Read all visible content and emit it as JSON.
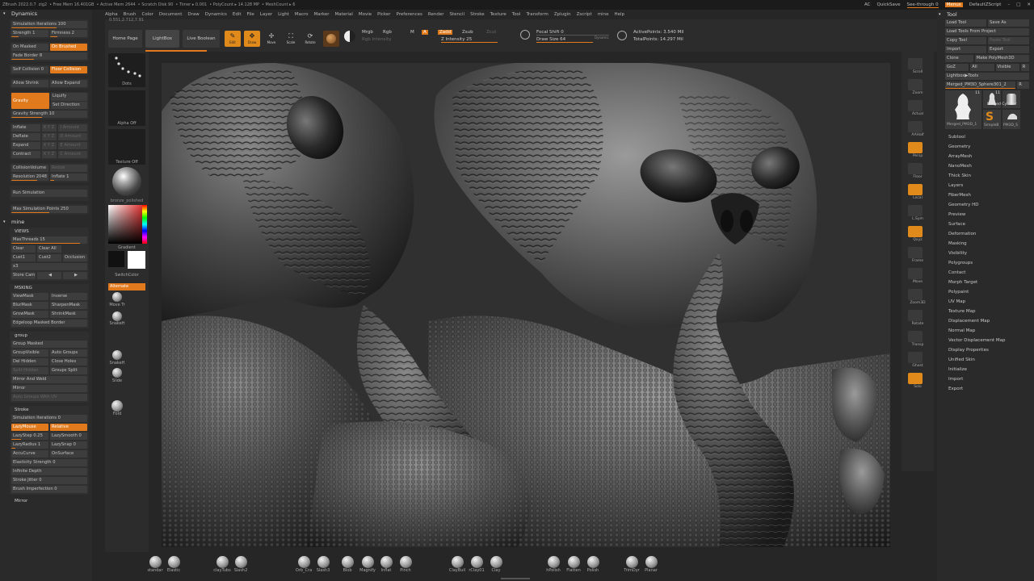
{
  "titlebar": {
    "items": [
      "ZBrush 2022.0.7",
      "zig2",
      "• Free Mem 16.401GB",
      "• Active Mem 2644",
      "• Scratch Disk 90",
      "• Timer ▸ 0.001",
      "• PolyCount ▸ 14.128 MP",
      "• MeshCount ▸ 6"
    ],
    "right": {
      "ac": "AC",
      "quicksave": "QuickSave",
      "seethrough": "See-through 0",
      "menus": "Menus",
      "script": "DefaultZScript"
    }
  },
  "menubar": [
    "Alpha",
    "Brush",
    "Color",
    "Document",
    "Draw",
    "Dynamics",
    "Edit",
    "File",
    "Layer",
    "Light",
    "Macro",
    "Marker",
    "Material",
    "Movie",
    "Picker",
    "Preferences",
    "Render",
    "Stencil",
    "Stroke",
    "Texture",
    "Tool",
    "Transform",
    "Zplugin",
    "Zscript",
    "mine",
    "Help"
  ],
  "coords": "0.551,2.712,7.91",
  "left": {
    "dynamics_title": "Dynamics",
    "sim_iterations": "Simulation Iterations 100",
    "strength": "Strength 1",
    "firmness": "Firmness 2",
    "on_masked": "On Masked",
    "on_brushed": "On Brushed",
    "fade_border": "Fade Border 8",
    "self_collision": "Self Collision 0",
    "floor_collision": "Floor Collision",
    "allow_shrink": "Allow Shrink",
    "allow_expand": "Allow Expand",
    "gravity": "Gravity",
    "liquify": "Liquify",
    "set_direction": "Set Direction",
    "gravity_strength": "Gravity Strength 10",
    "inflate": "Inflate",
    "deflate": "Deflate",
    "expand": "Expand",
    "contract": "Contract",
    "axes": "X Y Z",
    "amount_i": "I Amount",
    "amount_d": "D Amount",
    "amount_e": "E Amount",
    "amount_c": "C Amount",
    "collision_volume": "CollisionVolume",
    "resize": "Resize",
    "resolution": "Resolution 2048",
    "inflate1": "Inflate 1",
    "run_simulation": "Run Simulation",
    "max_sim_points": "Max Simulation Points 250",
    "mine_title": "mine",
    "views": "VIEWS",
    "max_threads": "MaxThreads 15",
    "clear": "Clear",
    "clear_all": "Clear All",
    "cust1": "Cust1",
    "cust2": "Cust2",
    "occlusion": "Occlusion",
    "x3": "x3",
    "store_cam": "Store Cam",
    "prev": "◀",
    "next": "▶",
    "masking": "MSKING",
    "view_mask": "ViewMask",
    "inverse": "Inverse",
    "blur_mask": "BlurMask",
    "sharpen_mask": "SharpenMask",
    "grow_mask": "GrowMask",
    "shrink_mask": "ShrinkMask",
    "edgeloop": "Edgeloop Masked Border",
    "group": "group",
    "group_masked": "Group Masked",
    "group_visible": "GroupVisible",
    "auto_groups": "Auto Groups",
    "del_hidden": "Del Hidden",
    "close_holes": "Close Holes",
    "split_hidden": "Split Hidden",
    "groups_split": "Groups Split",
    "mirror_weld": "Mirror And Weld",
    "mirror": "Mirror",
    "auto_groups_uv": "Auto Groups With UV",
    "stroke": "Stroke",
    "stroke_sim_iter": "Simulation Iterations 0",
    "lazy_mouse": "LazyMouse",
    "relative": "Relative",
    "lazy_step": "LazyStep 0.25",
    "lazy_smooth": "LazySmooth 0",
    "lazy_radius": "LazyRadius 1",
    "lazy_snap": "LazySnap 0",
    "accu_curve": "AccuCurve",
    "on_surface": "OnSurface",
    "elasticity": "Elasticity Strength 0",
    "infinite_depth": "Infinite Depth",
    "stroke_jitter": "Stroke Jitter 0",
    "brush_imperfection": "Brush Imperfection 0",
    "mirror2": "Mirror"
  },
  "toolstrip": {
    "home": "Home Page",
    "lightbox": "LightBox",
    "live_boolean": "Live Boolean",
    "edit": "Edit",
    "draw": "Draw",
    "move": "Move",
    "scale": "Scale",
    "rotate": "Rotate",
    "mrgb": "Mrgb",
    "rgb": "Rgb",
    "m": "M",
    "rgb_intensity": "Rgb Intensity",
    "a": "A",
    "zadd": "Zadd",
    "zsub": "Zsub",
    "zcut": "Zcut",
    "z_intensity": "Z Intensity 25",
    "focal_shift": "Focal Shift 0",
    "draw_size": "Draw Size 64",
    "dynamic": "Dynamic",
    "active_points": "ActivePoints: 3.540 Mil",
    "total_points": "TotalPoints: 14.297 Mil"
  },
  "shelf": {
    "dots": "Dots",
    "alpha_off": "Alpha Off",
    "texture_off": "Texture Off",
    "material": "bronze_polished",
    "gradient": "Gradient",
    "switch_color": "SwitchColor",
    "alternate": "Alternate",
    "move_tr": "Move Tr",
    "snakeh": "SnakeH",
    "snakeh2": "SnakeH",
    "slide": "Slide",
    "fold": "Fold"
  },
  "rightshelf": [
    "Scroll",
    "Zoom",
    "Actual",
    "AAHalf",
    "Persp",
    "Floor",
    "Local",
    "L.Sym",
    "Qxyz",
    "Frame",
    "Move",
    "Zoom3D",
    "Rotate",
    "Transp",
    "Ghost",
    "Solo"
  ],
  "right": {
    "tool_title": "Tool",
    "load_tool": "Load Tool",
    "save_as": "Save As",
    "load_project": "Load Tools From Project",
    "copy_tool": "Copy Tool",
    "paste_tool": "Paste Tool",
    "import": "Import",
    "export": "Export",
    "clone": "Clone",
    "make_polymesh": "Make PolyMesh3D",
    "goz": "GoZ",
    "all": "All",
    "visible": "Visible",
    "r": "R",
    "lightbox_tools": "Lightbox▶Tools",
    "merged": "Merged_PM3D_Sphere301_2",
    "r2": "R",
    "thumb_count1": "11",
    "thumb_count2": "11",
    "merged_cylinder": "Merged Cylinder",
    "merged_short": "Merged_PM3D_1",
    "simpleb": "SimpleB",
    "pm3d_s": "PM3D_S",
    "menu": [
      "Subtool",
      "Geometry",
      "ArrayMesh",
      "NanoMesh",
      "Thick Skin",
      "Layers",
      "FiberMesh",
      "Geometry HD",
      "Preview",
      "Surface",
      "Deformation",
      "Masking",
      "Visibility",
      "Polygroups",
      "Contact",
      "Morph Target",
      "Polypaint",
      "UV Map",
      "Texture Map",
      "Displacement Map",
      "Normal Map",
      "Vector Displacement Map",
      "Display Properties",
      "Unified Skin",
      "Initialize",
      "Import",
      "Export"
    ]
  },
  "brushes": [
    {
      "label": "standar"
    },
    {
      "label": "Elastic"
    },
    {
      "label": "clayTubs"
    },
    {
      "label": "Slash2"
    },
    {
      "label": "Orb_Cra"
    },
    {
      "label": "Slash3"
    },
    {
      "label": "Blob"
    },
    {
      "label": "Magnify"
    },
    {
      "label": "Inflat"
    },
    {
      "label": "Pinch"
    },
    {
      "label": "ClayBuil"
    },
    {
      "label": "rClay01"
    },
    {
      "label": "Clay"
    },
    {
      "label": "hPolish"
    },
    {
      "label": "Flatten"
    },
    {
      "label": "Polish"
    },
    {
      "label": "TrimDyr"
    },
    {
      "label": "Planar"
    }
  ],
  "colors": {
    "accent": "#e07a1c",
    "panel": "#2a2a2a",
    "button": "#3d3d3d"
  }
}
